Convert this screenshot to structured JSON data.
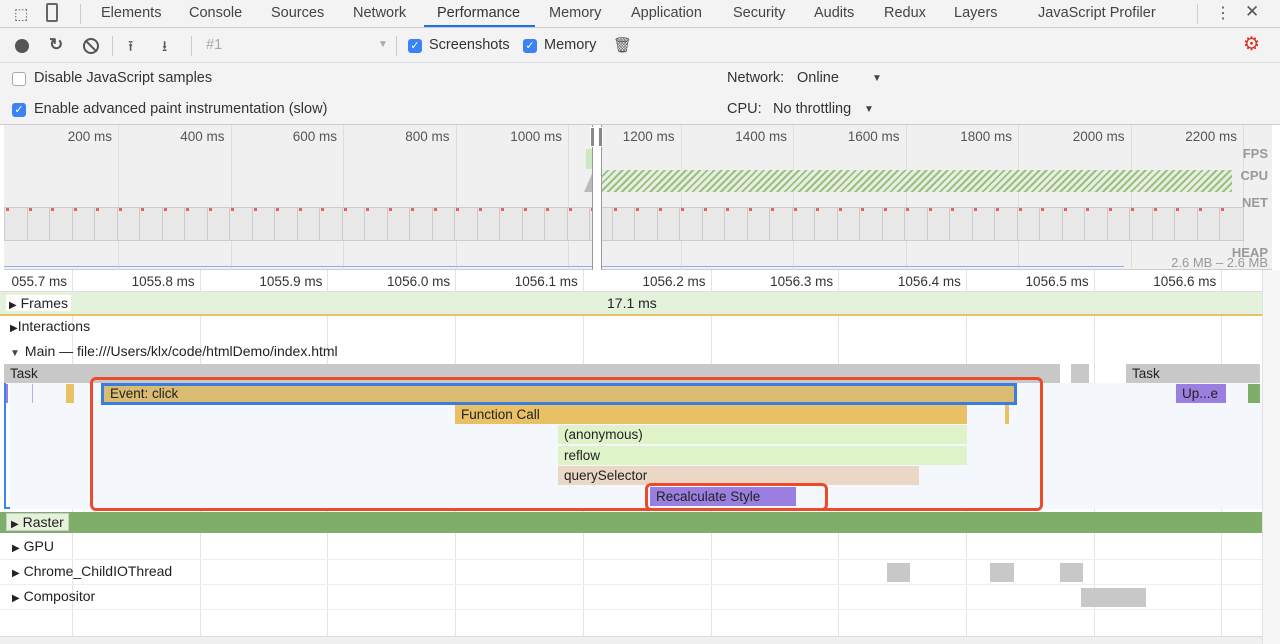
{
  "tabs": [
    "Elements",
    "Console",
    "Sources",
    "Network",
    "Performance",
    "Memory",
    "Application",
    "Security",
    "Audits",
    "Redux",
    "Layers",
    "JavaScript Profiler"
  ],
  "active_tab": "Performance",
  "toolbar": {
    "recording_select": "#1",
    "screenshots_label": "Screenshots",
    "screenshots_checked": true,
    "memory_label": "Memory",
    "memory_checked": true
  },
  "settings": {
    "disable_js_samples": "Disable JavaScript samples",
    "disable_js_checked": false,
    "advanced_paint": "Enable advanced paint instrumentation (slow)",
    "advanced_paint_checked": true,
    "network_label": "Network:",
    "network_value": "Online",
    "cpu_label": "CPU:",
    "cpu_value": "No throttling"
  },
  "overview": {
    "ticks": [
      "200 ms",
      "400 ms",
      "600 ms",
      "800 ms",
      "1000 ms",
      "1200 ms",
      "1400 ms",
      "1600 ms",
      "1800 ms",
      "2000 ms",
      "2200 ms"
    ],
    "fps": "FPS",
    "cpu": "CPU",
    "net": "NET",
    "heap": "HEAP",
    "heap_range": "2.6 MB – 2.6 MB"
  },
  "ruler": [
    "055.7 ms",
    "1055.8 ms",
    "1055.9 ms",
    "1056.0 ms",
    "1056.1 ms",
    "1056.2 ms",
    "1056.3 ms",
    "1056.4 ms",
    "1056.5 ms",
    "1056.6 ms"
  ],
  "tracks": {
    "frames": "Frames",
    "frame_duration": "17.1 ms",
    "interactions": "Interactions",
    "main": "Main — file:///Users/klx/code/htmlDemo/index.html",
    "raster": "Raster",
    "gpu": "GPU",
    "io": "Chrome_ChildIOThread",
    "compositor": "Compositor"
  },
  "flame": {
    "task1": "Task",
    "task2": "Task",
    "event_click": "Event: click",
    "update": "Up...e",
    "function_call": "Function Call",
    "anonymous": "(anonymous)",
    "reflow": "reflow",
    "query_selector": "querySelector",
    "recalc_style": "Recalculate Style"
  },
  "colors": {
    "accent": "#1a73e8",
    "highlight": "#ea4b2a",
    "scripting": "#e8c066",
    "rendering": "#9b7fe0",
    "raster": "#7fae6a"
  }
}
